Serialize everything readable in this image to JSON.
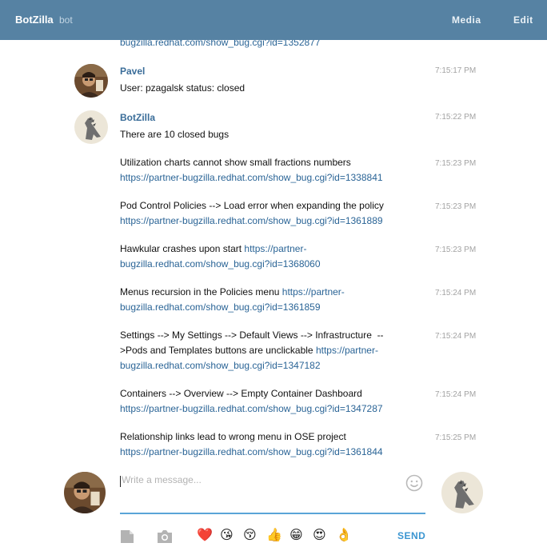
{
  "header": {
    "title": "BotZilla",
    "subtitle": "bot",
    "media_label": "Media",
    "edit_label": "Edit",
    "color": "#5682a3"
  },
  "messages": {
    "prev_link": "bugzilla.redhat.com/show_bug.cgi?id=1352877",
    "pavel": {
      "author": "Pavel",
      "time": "7:15:17 PM",
      "text": "User: pzagalsk status: closed"
    },
    "bot": {
      "author": "BotZilla",
      "time": "7:15:22 PM",
      "text": "There are 10 closed bugs"
    },
    "items": [
      {
        "text": "Utilization charts cannot show small fractions numbers",
        "link": "https://partner-bugzilla.redhat.com/show_bug.cgi?id=1338841",
        "time": "7:15:23 PM"
      },
      {
        "text": "Pod Control Policies --> Load error when expanding the policy",
        "link": "https://partner-bugzilla.redhat.com/show_bug.cgi?id=1361889",
        "time": "7:15:23 PM"
      },
      {
        "text": "Hawkular crashes upon start ",
        "link_a": "https://partner-",
        "link_b": "bugzilla.redhat.com/show_bug.cgi?id=1368060",
        "time": "7:15:23 PM"
      },
      {
        "text": "Menus recursion in the Policies menu ",
        "link_a": "https://partner-",
        "link_b": "bugzilla.redhat.com/show_bug.cgi?id=1361859",
        "time": "7:15:24 PM"
      },
      {
        "text_a": "Settings --> My Settings --> Default Views --> Infrastructure  --",
        "text_b": ">Pods and Templates buttons are unclickable ",
        "link_a": "https://partner-",
        "link_b": "bugzilla.redhat.com/show_bug.cgi?id=1347182",
        "time": "7:15:24 PM"
      },
      {
        "text": "Containers --> Overview --> Empty Container Dashboard",
        "link": "https://partner-bugzilla.redhat.com/show_bug.cgi?id=1347287",
        "time": "7:15:24 PM"
      },
      {
        "text": "Relationship links lead to wrong menu in OSE project",
        "link": "https://partner-bugzilla.redhat.com/show_bug.cgi?id=1361844",
        "time": "7:15:25 PM"
      }
    ]
  },
  "composer": {
    "placeholder": "Write a message...",
    "send_label": "SEND",
    "icons": [
      "file-icon",
      "camera-icon",
      "smiley-icon"
    ],
    "emojis": [
      "❤️",
      "😘",
      "😚",
      "👍",
      "😁",
      "😍",
      "👌"
    ]
  }
}
